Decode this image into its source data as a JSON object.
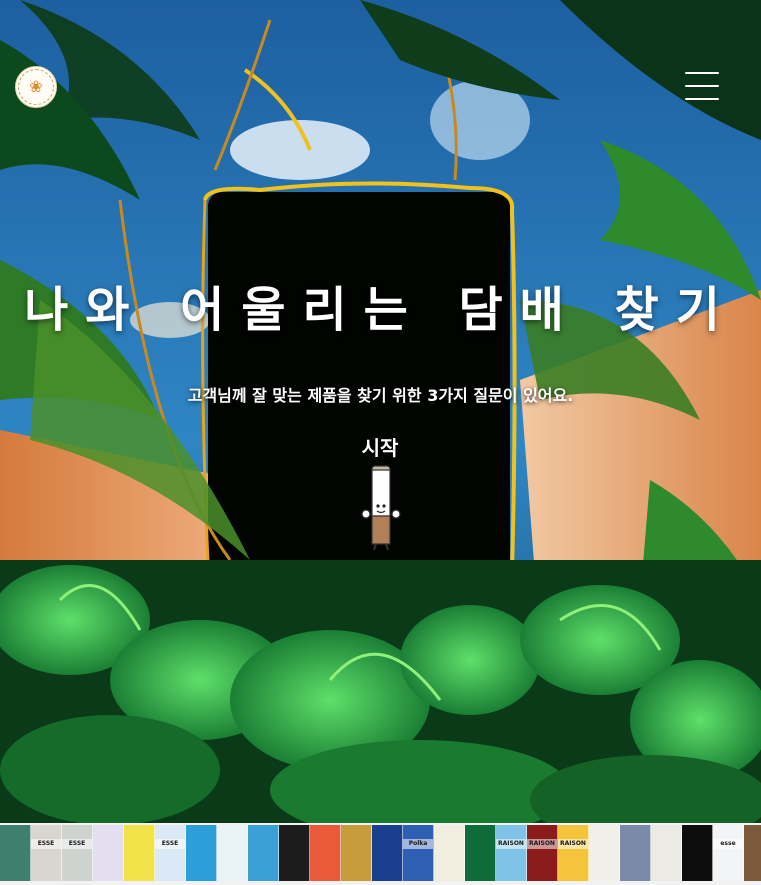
{
  "header": {
    "logo_icon": "brand-logo-icon",
    "menu_icon": "hamburger-menu-icon"
  },
  "hero": {
    "title": "나와 어울리는 담배 찾기",
    "subtitle": "고객님께 잘 맞는 제품을 찾기 위한 3가지 질문이 있어요.",
    "start_label": "시작",
    "mascot_icon": "cigarette-mascot-icon"
  },
  "packs": [
    {
      "color": "#3f7f6e",
      "label": ""
    },
    {
      "color": "#d9d6cf",
      "label": "ESSE"
    },
    {
      "color": "#cfd3d0",
      "label": "ESSE"
    },
    {
      "color": "#e3dff0",
      "label": ""
    },
    {
      "color": "#f2e24a",
      "label": ""
    },
    {
      "color": "#dbe8f5",
      "label": "ESSE"
    },
    {
      "color": "#2d9fd8",
      "label": ""
    },
    {
      "color": "#e9f3f8",
      "label": ""
    },
    {
      "color": "#3aa0d6",
      "label": ""
    },
    {
      "color": "#1c1c1c",
      "label": ""
    },
    {
      "color": "#e85a3a",
      "label": ""
    },
    {
      "color": "#c89b3c",
      "label": ""
    },
    {
      "color": "#1b3f8f",
      "label": ""
    },
    {
      "color": "#2f5fb3",
      "label": "Polka"
    },
    {
      "color": "#f1eee0",
      "label": ""
    },
    {
      "color": "#0f6b3a",
      "label": ""
    },
    {
      "color": "#7fc4e8",
      "label": "RAISON"
    },
    {
      "color": "#8b1a1a",
      "label": "RAISON"
    },
    {
      "color": "#f4c43a",
      "label": "RAISON"
    },
    {
      "color": "#f0efe8",
      "label": ""
    },
    {
      "color": "#7a8aa8",
      "label": ""
    },
    {
      "color": "#eceae4",
      "label": ""
    },
    {
      "color": "#0d0d0d",
      "label": ""
    },
    {
      "color": "#f3f4f6",
      "label": "esse"
    },
    {
      "color": "#7a5a3a",
      "label": ""
    },
    {
      "color": "#e8e8e8",
      "label": ""
    }
  ]
}
